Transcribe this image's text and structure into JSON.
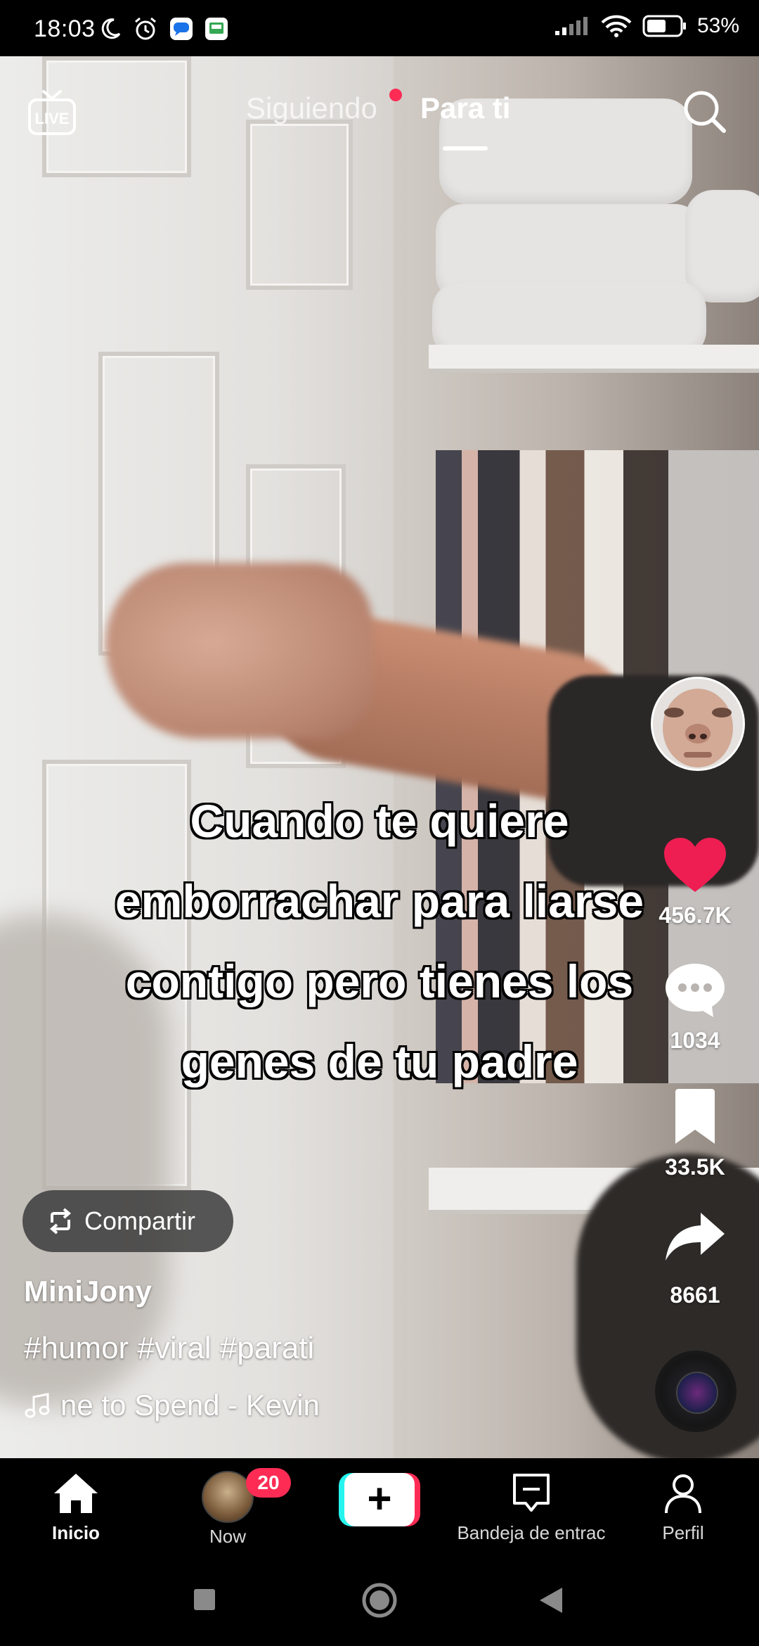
{
  "status_bar": {
    "time": "18:03",
    "battery_percent": "53%",
    "icons": [
      "moon-icon",
      "alarm-icon",
      "messages-icon",
      "screen-icon",
      "signal-icon",
      "wifi-icon",
      "battery-icon"
    ]
  },
  "top_nav": {
    "live_label": "LIVE",
    "tabs": [
      {
        "label": "Siguiendo",
        "active": false,
        "has_dot": true
      },
      {
        "label": "Para ti",
        "active": true
      }
    ]
  },
  "video": {
    "caption": "Cuando te quiere emborrachar para liarse contigo pero tienes los genes de tu padre"
  },
  "actions": {
    "likes": "456.7K",
    "comments": "1034",
    "bookmarks": "33.5K",
    "shares": "8661"
  },
  "info": {
    "share_label": "Compartir",
    "username": "MiniJony",
    "hashtags": "#humor #viral #parati",
    "music": "ne to Spend - Kevin"
  },
  "tabbar": {
    "items": [
      {
        "label": "Inicio",
        "active": true
      },
      {
        "label": "Now",
        "badge": "20"
      },
      {
        "label": ""
      },
      {
        "label": "Bandeja de entrac"
      },
      {
        "label": "Perfil"
      }
    ]
  },
  "colors": {
    "accent_red": "#fe2c55",
    "accent_cyan": "#25f4ee",
    "like_red": "#ee1d52"
  }
}
